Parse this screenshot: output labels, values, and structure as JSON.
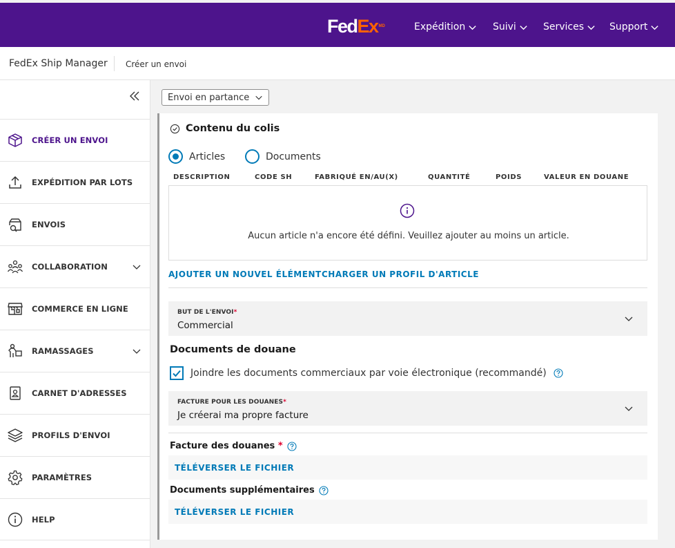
{
  "brand": {
    "logo_fed": "Fed",
    "logo_ex": "Ex",
    "logo_tm": "MD"
  },
  "topnav": {
    "items": [
      {
        "label": "Expédition"
      },
      {
        "label": "Suivi"
      },
      {
        "label": "Services"
      },
      {
        "label": "Support"
      }
    ]
  },
  "subheader": {
    "app": "FedEx Ship Manager",
    "crumb": "Créer un envoi"
  },
  "sidebar": {
    "items": [
      {
        "label": "CRÉER UN ENVOI",
        "icon": "package-icon",
        "active": true
      },
      {
        "label": "EXPÉDITION PAR LOTS",
        "icon": "upload-icon"
      },
      {
        "label": "ENVOIS",
        "icon": "search-box-icon"
      },
      {
        "label": "COLLABORATION",
        "icon": "users-icon",
        "expandable": true
      },
      {
        "label": "COMMERCE EN LIGNE",
        "icon": "store-icon"
      },
      {
        "label": "RAMASSAGES",
        "icon": "pickup-icon",
        "expandable": true
      },
      {
        "label": "CARNET D'ADRESSES",
        "icon": "address-book-icon"
      },
      {
        "label": "PROFILS D'ENVOI",
        "icon": "layers-icon"
      },
      {
        "label": "PARAMÈTRES",
        "icon": "gear-icon"
      },
      {
        "label": "HELP",
        "icon": "info-icon"
      }
    ]
  },
  "shipment_type": {
    "value": "Envoi en partance"
  },
  "package": {
    "title": "Contenu du colis",
    "radio_articles": "Articles",
    "radio_documents": "Documents",
    "selected": "Articles",
    "columns": [
      "DESCRIPTION",
      "CODE SH",
      "FABRIQUÉ EN/AU(X)",
      "QUANTITÉ",
      "POIDS",
      "VALEUR EN DOUANE"
    ],
    "empty_message": "Aucun article n'a encore été défini. Veuillez ajouter au moins un article.",
    "add_link": "AJOUTER UN NOUVEL ÉLÉMENT",
    "load_profile_link": "CHARGER UN PROFIL D'ARTICLE"
  },
  "purpose": {
    "label": "BUT DE L'ENVOI",
    "required": "*",
    "value": "Commercial"
  },
  "customs": {
    "title": "Documents de douane",
    "checkbox_label": "Joindre les documents commerciaux par voie électronique (recommandé)",
    "checked": true,
    "invoice_label": "FACTURE POUR LES DOUANES",
    "invoice_required": "*",
    "invoice_value": "Je créerai ma propre facture",
    "customs_invoice_title": "Facture des douanes",
    "customs_invoice_required": "*",
    "upload_label": "TÉLÉVERSER LE FICHIER",
    "extra_docs_title": "Documents supplémentaires",
    "upload_label_2": "TÉLÉVERSER LE FICHIER"
  },
  "colors": {
    "brand_purple": "#4d148c",
    "brand_orange": "#ff6200",
    "link_blue": "#007ab7",
    "required_red": "#de002e"
  }
}
